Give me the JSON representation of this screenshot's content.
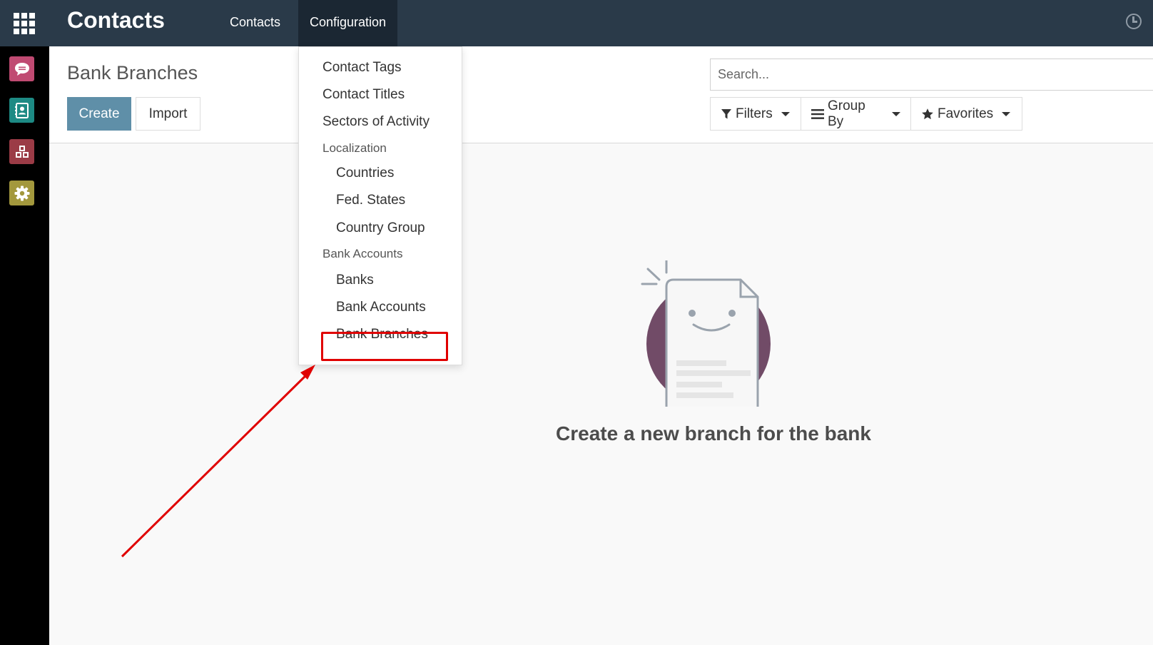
{
  "navbar": {
    "brand": "Contacts",
    "menu": [
      "Contacts",
      "Configuration"
    ],
    "icons": {
      "apps": "grid-icon",
      "activity": "clock-icon"
    }
  },
  "app_sidebar": [
    {
      "name": "discuss",
      "icon": "chat-bubble-icon",
      "color": "#c04a72"
    },
    {
      "name": "contacts",
      "icon": "address-book-icon",
      "color": "#1d8a84"
    },
    {
      "name": "apps",
      "icon": "cubes-icon",
      "color": "#9b3b46"
    },
    {
      "name": "settings",
      "icon": "gear-icon",
      "color": "#a3983d"
    }
  ],
  "control_panel": {
    "breadcrumb": "Bank Branches",
    "create_label": "Create",
    "import_label": "Import",
    "search_placeholder": "Search...",
    "filters_label": "Filters",
    "groupby_label": "Group By",
    "favorites_label": "Favorites"
  },
  "config_menu": {
    "items": {
      "contact_tags": "Contact Tags",
      "contact_titles": "Contact Titles",
      "sectors": "Sectors of Activity",
      "localization_header": "Localization",
      "countries": "Countries",
      "fed_states": "Fed. States",
      "country_group": "Country Group",
      "bank_accounts_header": "Bank Accounts",
      "banks": "Banks",
      "bank_accounts": "Bank Accounts",
      "bank_branches": "Bank Branches"
    },
    "highlighted": "Bank Branches"
  },
  "empty_state": {
    "title": "Create a new branch for the bank"
  },
  "colors": {
    "navbar": "#2a3a49",
    "active_menu": "#1b2733",
    "primary_button": "#5f8fa8",
    "annotation": "#e00000",
    "illustration_circle": "#714b67"
  }
}
